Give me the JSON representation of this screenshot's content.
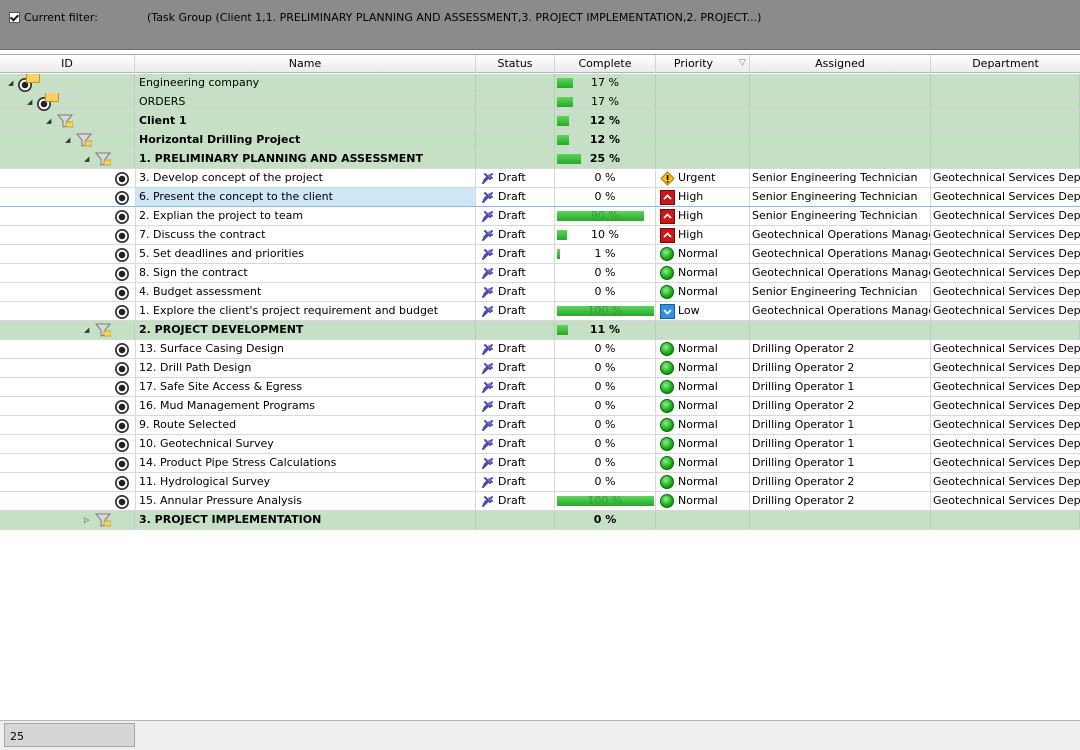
{
  "filter": {
    "label": "Current filter:",
    "checked": true,
    "text": "(Task Group  (Client 1,1. PRELIMINARY PLANNING AND ASSESSMENT,3. PROJECT IMPLEMENTATION,2. PROJECT...)"
  },
  "columns": [
    {
      "key": "id",
      "label": "ID"
    },
    {
      "key": "name",
      "label": "Name"
    },
    {
      "key": "status",
      "label": "Status"
    },
    {
      "key": "complete",
      "label": "Complete"
    },
    {
      "key": "priority",
      "label": "Priority"
    },
    {
      "key": "assigned",
      "label": "Assigned"
    },
    {
      "key": "department",
      "label": "Department"
    }
  ],
  "sort_icon": "sort-desc-icon",
  "rows": [
    {
      "type": "group",
      "level": 0,
      "icon": "node-folder",
      "name": "Engineering company",
      "bold": false,
      "complete": 17
    },
    {
      "type": "group",
      "level": 1,
      "icon": "node-folder",
      "name": "ORDERS",
      "bold": false,
      "complete": 17
    },
    {
      "type": "group",
      "level": 2,
      "icon": "filter",
      "name": "Client 1",
      "bold": true,
      "complete": 12
    },
    {
      "type": "group",
      "level": 3,
      "icon": "filter",
      "name": "Horizontal Drilling Project",
      "bold": true,
      "complete": 12
    },
    {
      "type": "group",
      "level": 4,
      "icon": "filter",
      "name": "1. PRELIMINARY PLANNING AND ASSESSMENT",
      "bold": true,
      "complete": 25
    },
    {
      "type": "task",
      "name": "3. Develop concept of the project",
      "status": "Draft",
      "complete": 0,
      "priority": "Urgent",
      "assigned": "Senior Engineering Technician",
      "department": "Geotechnical Services Departr"
    },
    {
      "type": "task",
      "selected": true,
      "name": "6. Present the concept to the client",
      "status": "Draft",
      "complete": 0,
      "priority": "High",
      "assigned": "Senior Engineering Technician",
      "department": "Geotechnical Services Departr"
    },
    {
      "type": "task",
      "name": "2. Explian the project to team",
      "status": "Draft",
      "complete": 90,
      "priority": "High",
      "assigned": "Senior Engineering Technician",
      "department": "Geotechnical Services Departr"
    },
    {
      "type": "task",
      "name": "7. Discuss the contract",
      "status": "Draft",
      "complete": 10,
      "priority": "High",
      "assigned": "Geotechnical Operations Manager",
      "department": "Geotechnical Services Departr"
    },
    {
      "type": "task",
      "name": "5. Set deadlines and priorities",
      "status": "Draft",
      "complete": 1,
      "priority": "Normal",
      "assigned": "Geotechnical Operations Manager",
      "department": "Geotechnical Services Departr"
    },
    {
      "type": "task",
      "name": "8. Sign the contract",
      "status": "Draft",
      "complete": 0,
      "priority": "Normal",
      "assigned": "Geotechnical Operations Manager",
      "department": "Geotechnical Services Departr"
    },
    {
      "type": "task",
      "name": "4. Budget assessment",
      "status": "Draft",
      "complete": 0,
      "priority": "Normal",
      "assigned": "Senior Engineering Technician",
      "department": "Geotechnical Services Departr"
    },
    {
      "type": "task",
      "name": "1. Explore the client's project requirement and budget",
      "status": "Draft",
      "complete": 100,
      "priority": "Low",
      "assigned": "Geotechnical Operations Manager",
      "department": "Geotechnical Services Departr"
    },
    {
      "type": "group",
      "level": 4,
      "icon": "filter",
      "name": "2. PROJECT DEVELOPMENT",
      "bold": true,
      "complete": 11
    },
    {
      "type": "task",
      "name": "13. Surface Casing Design",
      "status": "Draft",
      "complete": 0,
      "priority": "Normal",
      "assigned": "Drilling Operator 2",
      "department": "Geotechnical Services Departr"
    },
    {
      "type": "task",
      "name": "12. Drill Path Design",
      "status": "Draft",
      "complete": 0,
      "priority": "Normal",
      "assigned": "Drilling Operator 2",
      "department": "Geotechnical Services Departr"
    },
    {
      "type": "task",
      "name": "17. Safe Site Access & Egress",
      "status": "Draft",
      "complete": 0,
      "priority": "Normal",
      "assigned": "Drilling Operator 1",
      "department": "Geotechnical Services Departr"
    },
    {
      "type": "task",
      "name": "16. Mud Management Programs",
      "status": "Draft",
      "complete": 0,
      "priority": "Normal",
      "assigned": "Drilling Operator 2",
      "department": "Geotechnical Services Departr"
    },
    {
      "type": "task",
      "name": "9. Route Selected",
      "status": "Draft",
      "complete": 0,
      "priority": "Normal",
      "assigned": "Drilling Operator 1",
      "department": "Geotechnical Services Departr"
    },
    {
      "type": "task",
      "name": "10. Geotechnical Survey",
      "status": "Draft",
      "complete": 0,
      "priority": "Normal",
      "assigned": "Drilling Operator 1",
      "department": "Geotechnical Services Departr"
    },
    {
      "type": "task",
      "name": "14. Product Pipe Stress Calculations",
      "status": "Draft",
      "complete": 0,
      "priority": "Normal",
      "assigned": "Drilling Operator 1",
      "department": "Geotechnical Services Departr"
    },
    {
      "type": "task",
      "name": "11. Hydrological Survey",
      "status": "Draft",
      "complete": 0,
      "priority": "Normal",
      "assigned": "Drilling Operator 2",
      "department": "Geotechnical Services Departr"
    },
    {
      "type": "task",
      "name": "15. Annular Pressure Analysis",
      "status": "Draft",
      "complete": 100,
      "priority": "Normal",
      "assigned": "Drilling Operator 2",
      "department": "Geotechnical Services Departr"
    },
    {
      "type": "group",
      "level": 4,
      "icon": "filter",
      "collapsed": true,
      "name": "3. PROJECT IMPLEMENTATION",
      "bold": true,
      "complete": 0
    }
  ],
  "footer": {
    "count": "25"
  },
  "colors": {
    "group_bg": "#c6e0c6",
    "progress": "#2db82d",
    "selection": "#cfe6f6",
    "filter_panel": "#8b8b8b"
  }
}
